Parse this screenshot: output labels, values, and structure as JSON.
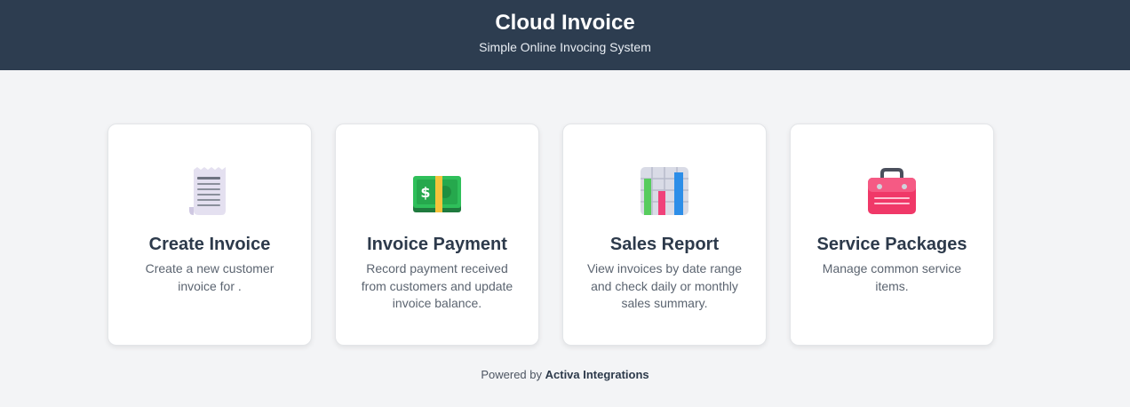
{
  "header": {
    "title": "Cloud Invoice",
    "subtitle": "Simple Online Invocing System"
  },
  "cards": [
    {
      "title": "Create Invoice",
      "description": "Create a new customer invoice for .",
      "icon": "receipt-icon"
    },
    {
      "title": "Invoice Payment",
      "description": "Record payment received from customers and update invoice balance.",
      "icon": "money-icon"
    },
    {
      "title": "Sales Report",
      "description": "View invoices by date range and check daily or monthly sales summary.",
      "icon": "bar-chart-icon"
    },
    {
      "title": "Service Packages",
      "description": "Manage common service items.",
      "icon": "toolbox-icon"
    }
  ],
  "footer": {
    "prefix": "Powered by",
    "brand": "Activa Integrations"
  },
  "colors": {
    "header_bg": "#2d3d50",
    "page_bg": "#f3f4f6",
    "card_bg": "#ffffff",
    "title_text": "#2d3a4b"
  }
}
